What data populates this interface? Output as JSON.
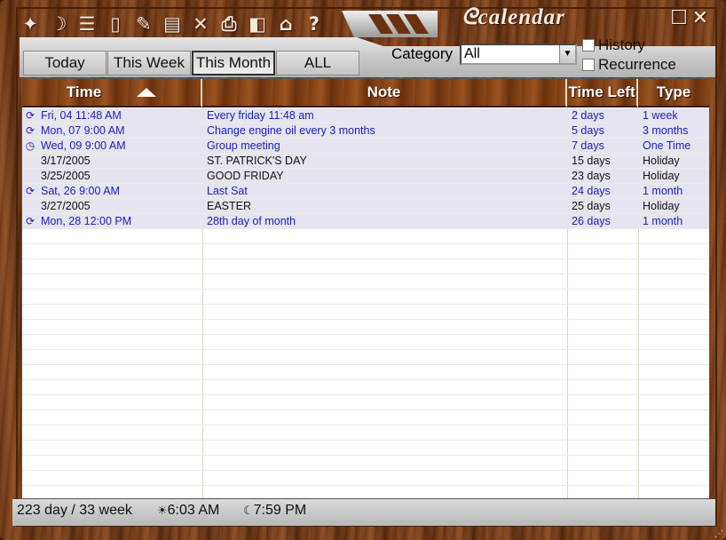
{
  "app": {
    "title": "calendar"
  },
  "toolbar": {
    "icons": [
      "new-icon",
      "moon-icon",
      "list-icon",
      "note-icon",
      "pencil-icon",
      "document-icon",
      "delete-icon",
      "print-icon",
      "shapes-icon",
      "home-icon",
      "help-icon"
    ]
  },
  "tabs": [
    {
      "label": "Today"
    },
    {
      "label": "This Week"
    },
    {
      "label": "This Month"
    },
    {
      "label": "ALL"
    }
  ],
  "active_tab": "This Month",
  "filter": {
    "category_label": "Category",
    "category_value": "All",
    "history_label": "History",
    "recurrence_label": "Recurrence"
  },
  "table": {
    "headers": {
      "time": "Time",
      "note": "Note",
      "time_left": "Time Left",
      "type": "Type"
    },
    "rows": [
      {
        "icon": "recurring-icon",
        "time": "Fri, 04 11:48 AM",
        "note": "Every friday 11:48 am",
        "time_left": "2 days",
        "type": "1 week",
        "color": "blue"
      },
      {
        "icon": "recurring-icon",
        "time": "Mon, 07 9:00 AM",
        "note": "Change engine oil every 3 months",
        "time_left": "5 days",
        "type": "3 months",
        "color": "blue"
      },
      {
        "icon": "clock-icon",
        "time": "Wed, 09 9:00 AM",
        "note": "Group meeting",
        "time_left": "7 days",
        "type": "One Time",
        "color": "blue"
      },
      {
        "icon": "",
        "time": "3/17/2005",
        "note": "ST. PATRICK'S DAY",
        "time_left": "15 days",
        "type": "Holiday",
        "color": "dark"
      },
      {
        "icon": "",
        "time": "3/25/2005",
        "note": "GOOD FRIDAY",
        "time_left": "23 days",
        "type": "Holiday",
        "color": "dark"
      },
      {
        "icon": "recurring-icon",
        "time": "Sat, 26 9:00 AM",
        "note": "Last Sat",
        "time_left": "24 days",
        "type": "1 month",
        "color": "blue"
      },
      {
        "icon": "",
        "time": "3/27/2005",
        "note": "EASTER",
        "time_left": "25 days",
        "type": "Holiday",
        "color": "dark"
      },
      {
        "icon": "recurring-icon",
        "time": "Mon, 28 12:00 PM",
        "note": "28th day of month",
        "time_left": "26 days",
        "type": "1 month",
        "color": "blue"
      }
    ]
  },
  "status": {
    "day_week": "223 day / 33 week",
    "sunrise": "6:03 AM",
    "sunset": "7:59 PM"
  }
}
